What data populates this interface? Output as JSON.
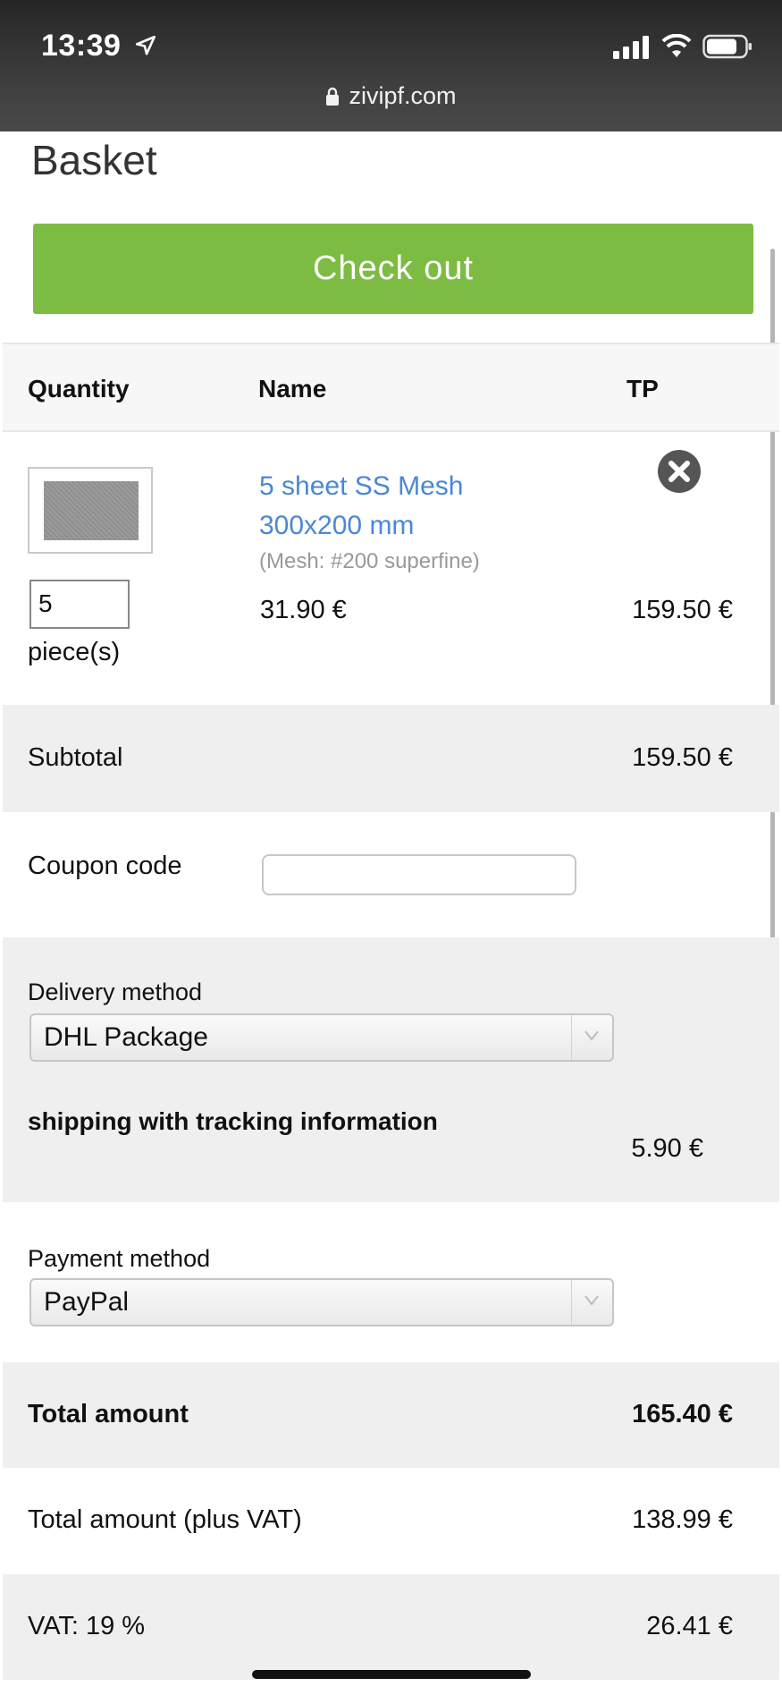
{
  "status_bar": {
    "time": "13:39",
    "url": "zivipf.com"
  },
  "page": {
    "title": "Basket",
    "checkout_label": "Check out"
  },
  "table": {
    "headers": {
      "quantity": "Quantity",
      "name": "Name",
      "tp": "TP"
    },
    "item": {
      "quantity": "5",
      "unit_label": "piece(s)",
      "name_line1": "5 sheet SS Mesh",
      "name_line2": "300x200 mm",
      "option": "(Mesh: #200 superfine)",
      "unit_price": "31.90 €",
      "total_price": "159.50 €"
    }
  },
  "subtotal": {
    "label": "Subtotal",
    "value": "159.50 €"
  },
  "coupon": {
    "label": "Coupon code",
    "value": ""
  },
  "delivery": {
    "label": "Delivery method",
    "selected": "DHL Package",
    "description": "shipping with tracking information",
    "price": "5.90 €"
  },
  "payment": {
    "label": "Payment method",
    "selected": "PayPal"
  },
  "totals": {
    "total_label": "Total amount",
    "total_value": "165.40 €",
    "net_label": "Total amount (plus VAT)",
    "net_value": "138.99 €",
    "vat_label": "VAT: 19 %",
    "vat_value": "26.41 €"
  },
  "colors": {
    "accent_green": "#7dbc42",
    "link_blue": "#4a87d6",
    "row_grey": "#efefef"
  }
}
